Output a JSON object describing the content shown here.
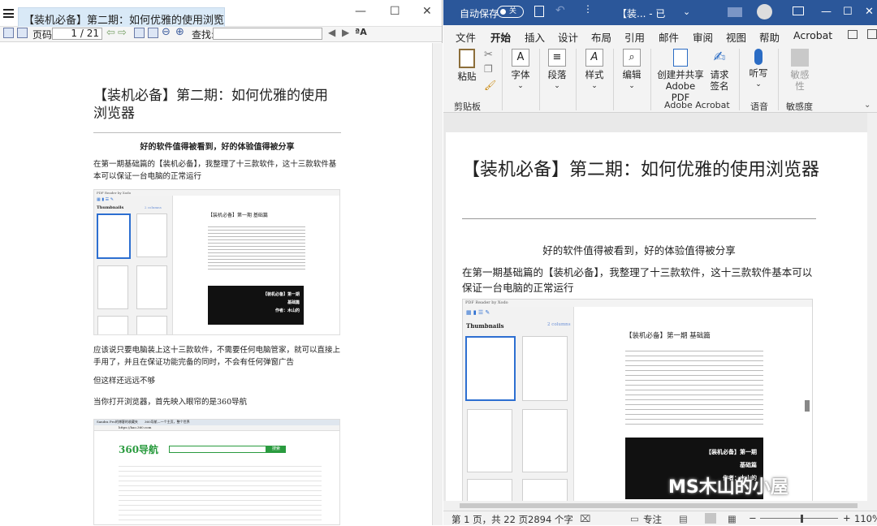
{
  "left_app": {
    "tab_title": "【装机必备】第二期：如何优雅的使用浏览器.pdf",
    "tab_close": "×",
    "window_controls": [
      "—",
      "☐",
      "✕"
    ],
    "toolbar": {
      "page_label": "页码:",
      "page_value": "1 / 21",
      "find_label": "查找:"
    },
    "doc": {
      "title": "【装机必备】第二期：如何优雅的使用浏览器",
      "subtitle": "好的软件值得被看到，好的体验值得被分享",
      "p1": "在第一期基础篇的【装机必备】，我整理了十三款软件，这十三款软件基本可以保证一台电脑的正常运行",
      "p2": "应该说只要电脑装上这十三款软件，不需要任何电脑管家，就可以直接上手用了，并且在保证功能完备的同时，不会有任何弹窗广告",
      "p3": "但这样还远远不够",
      "p4": "当你打开浏览器，首先映入眼帘的是360导航"
    },
    "embed": {
      "app": "PDF Reader by Xodo",
      "thumbnails_label": "Thumbnails",
      "columns": "2 columns",
      "page_title": "【装机必备】第一期 基础篇",
      "banner_line1": "【装机必备】第一期",
      "banner_line2": "基础篇",
      "banner_author": "作者：木山的"
    },
    "browser": {
      "tab1": "Sandra Pro的博客的收藏夹",
      "tab2": "360导航—一个主页，整个世界",
      "url": "https://hao.360.com",
      "logo": "360导航",
      "search_btn": "搜索"
    }
  },
  "word": {
    "autosave": "自动保存",
    "toggle": "关",
    "title": "【装... - 已",
    "tabs": [
      "文件",
      "开始",
      "插入",
      "设计",
      "布局",
      "引用",
      "邮件",
      "审阅",
      "视图",
      "帮助",
      "Acrobat"
    ],
    "active_tab": "开始",
    "ribbon": {
      "paste": "粘贴",
      "clipboard": "剪贴板",
      "font": "字体",
      "paragraph": "段落",
      "styles": "样式",
      "editing": "编辑",
      "create_share": "创建并共享",
      "adobe_pdf": "Adobe PDF",
      "request_sign1": "请求",
      "request_sign2": "签名",
      "adobe_acrobat": "Adobe Acrobat",
      "dictate": "听写",
      "voice": "语音",
      "sensitivity_btn1": "敏感",
      "sensitivity_btn2": "性",
      "sensitivity": "敏感度"
    },
    "doc": {
      "title": "【装机必备】第二期：如何优雅的使用浏览器",
      "subtitle": "好的软件值得被看到，好的体验值得被分享",
      "p1": "在第一期基础篇的【装机必备】，我整理了十三款软件，这十三款软件基本可以保证一台电脑的正常运行"
    },
    "status": {
      "page": "第 1 页，共 22 页",
      "words": "2894 个字",
      "focus": "专注",
      "zoom": "110%"
    }
  },
  "watermark": "MS木山的小屋"
}
